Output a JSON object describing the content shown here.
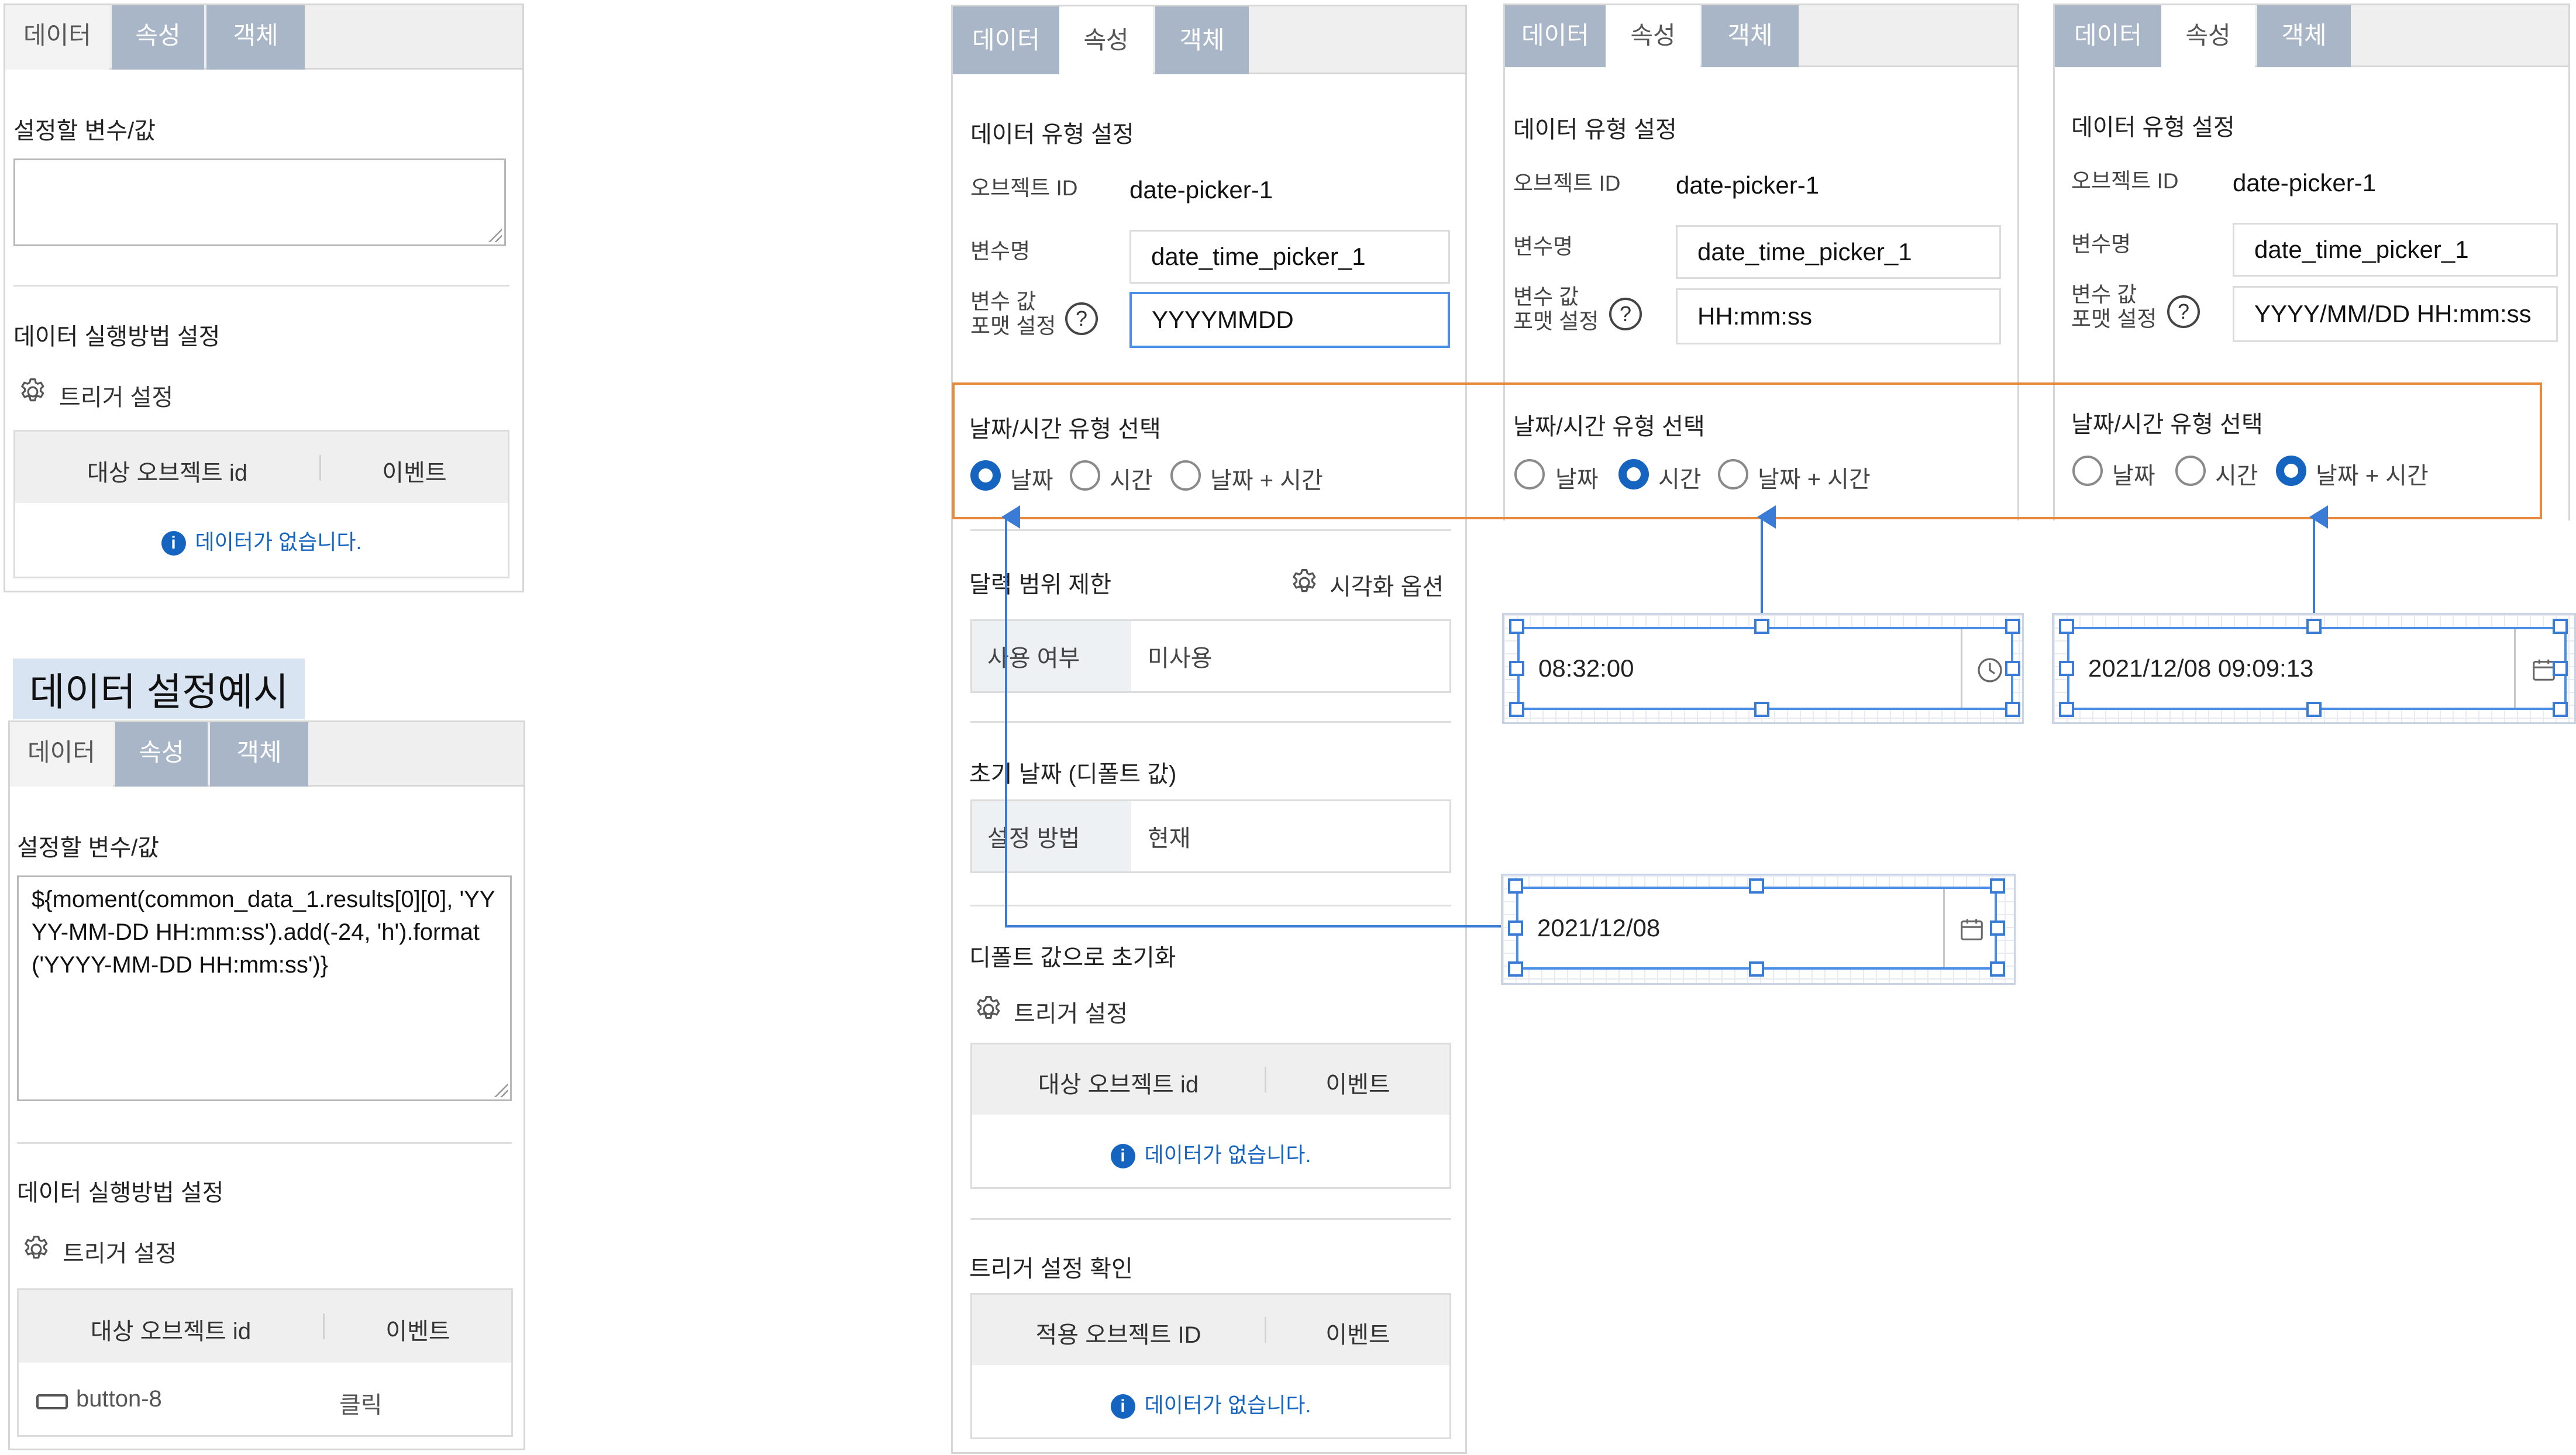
{
  "tabs": {
    "data": "데이터",
    "property": "속성",
    "object": "객체"
  },
  "panel1": {
    "variable_title": "설정할 변수/값",
    "variable_value": "",
    "exec_title": "데이터 실행방법 설정",
    "trigger_label": "트리거 설정",
    "table_headers": [
      "대상 오브젝트 id",
      "이벤트"
    ],
    "empty_text": "데이터가 없습니다."
  },
  "example_caption": "데이터 설정예시",
  "panel2": {
    "variable_title": "설정할 변수/값",
    "variable_value": "${moment(common_data_1.results[0][0], 'YYYY-MM-DD HH:mm:ss').add(-24, 'h').format('YYYY-MM-DD HH:mm:ss')}",
    "exec_title": "데이터 실행방법 설정",
    "trigger_label": "트리거 설정",
    "table_headers": [
      "대상 오브젝트 id",
      "이벤트"
    ],
    "row": {
      "object": "button-8",
      "event": "클릭"
    }
  },
  "main": {
    "type_title": "데이터 유형 설정",
    "object_id_label": "오브젝트 ID",
    "object_id": "date-picker-1",
    "var_name_label": "변수명",
    "var_name": "date_time_picker_1",
    "format_label_1": "변수 값",
    "format_label_2": "포맷 설정",
    "format_value": "YYYYMMDD",
    "dt_title": "날짜/시간 유형 선택",
    "radio_date": "날짜",
    "radio_time": "시간",
    "radio_datetime": "날짜 + 시간",
    "range_title": "달력 범위 제한",
    "visual_option": "시각화 옵션",
    "use_label": "사용 여부",
    "use_value": "미사용",
    "init_title": "초기 날짜 (디폴트 값)",
    "method_label": "설정 방법",
    "method_value": "현재",
    "reset_title": "디폴트 값으로 초기화",
    "trigger_label": "트리거 설정",
    "table_headers": [
      "대상 오브젝트 id",
      "이벤트"
    ],
    "empty_text": "데이터가 없습니다.",
    "confirm_title": "트리거 설정 확인",
    "confirm_headers": [
      "적용 오브젝트 ID",
      "이벤트"
    ],
    "confirm_empty": "데이터가 없습니다."
  },
  "variant_time": {
    "type_title": "데이터 유형 설정",
    "object_id_label": "오브젝트 ID",
    "object_id": "date-picker-1",
    "var_name_label": "변수명",
    "var_name": "date_time_picker_1",
    "format_label_1": "변수 값",
    "format_label_2": "포맷 설정",
    "format_value": "HH:mm:ss",
    "dt_title": "날짜/시간 유형 선택",
    "radio_date": "날짜",
    "radio_time": "시간",
    "radio_datetime": "날짜 + 시간"
  },
  "variant_datetime": {
    "type_title": "데이터 유형 설정",
    "object_id_label": "오브젝트 ID",
    "object_id": "date-picker-1",
    "var_name_label": "변수명",
    "var_name": "date_time_picker_1",
    "format_label_1": "변수 값",
    "format_label_2": "포맷 설정",
    "format_value": "YYYY/MM/DD HH:mm:ss",
    "dt_title": "날짜/시간 유형 선택",
    "radio_date": "날짜",
    "radio_time": "시간",
    "radio_datetime": "날짜 + 시간"
  },
  "widgets": {
    "time_value": "08:32:00",
    "datetime_value": "2021/12/08 09:09:13",
    "date_value": "2021/12/08"
  },
  "colors": {
    "accent": "#1565c0",
    "highlight": "#e8893b",
    "connector": "#3a7bd5",
    "tab_inactive": "#a8b6c8"
  },
  "icons": [
    "gear-icon",
    "info-icon",
    "help-icon",
    "clock-icon",
    "calendar-icon",
    "button-icon"
  ]
}
